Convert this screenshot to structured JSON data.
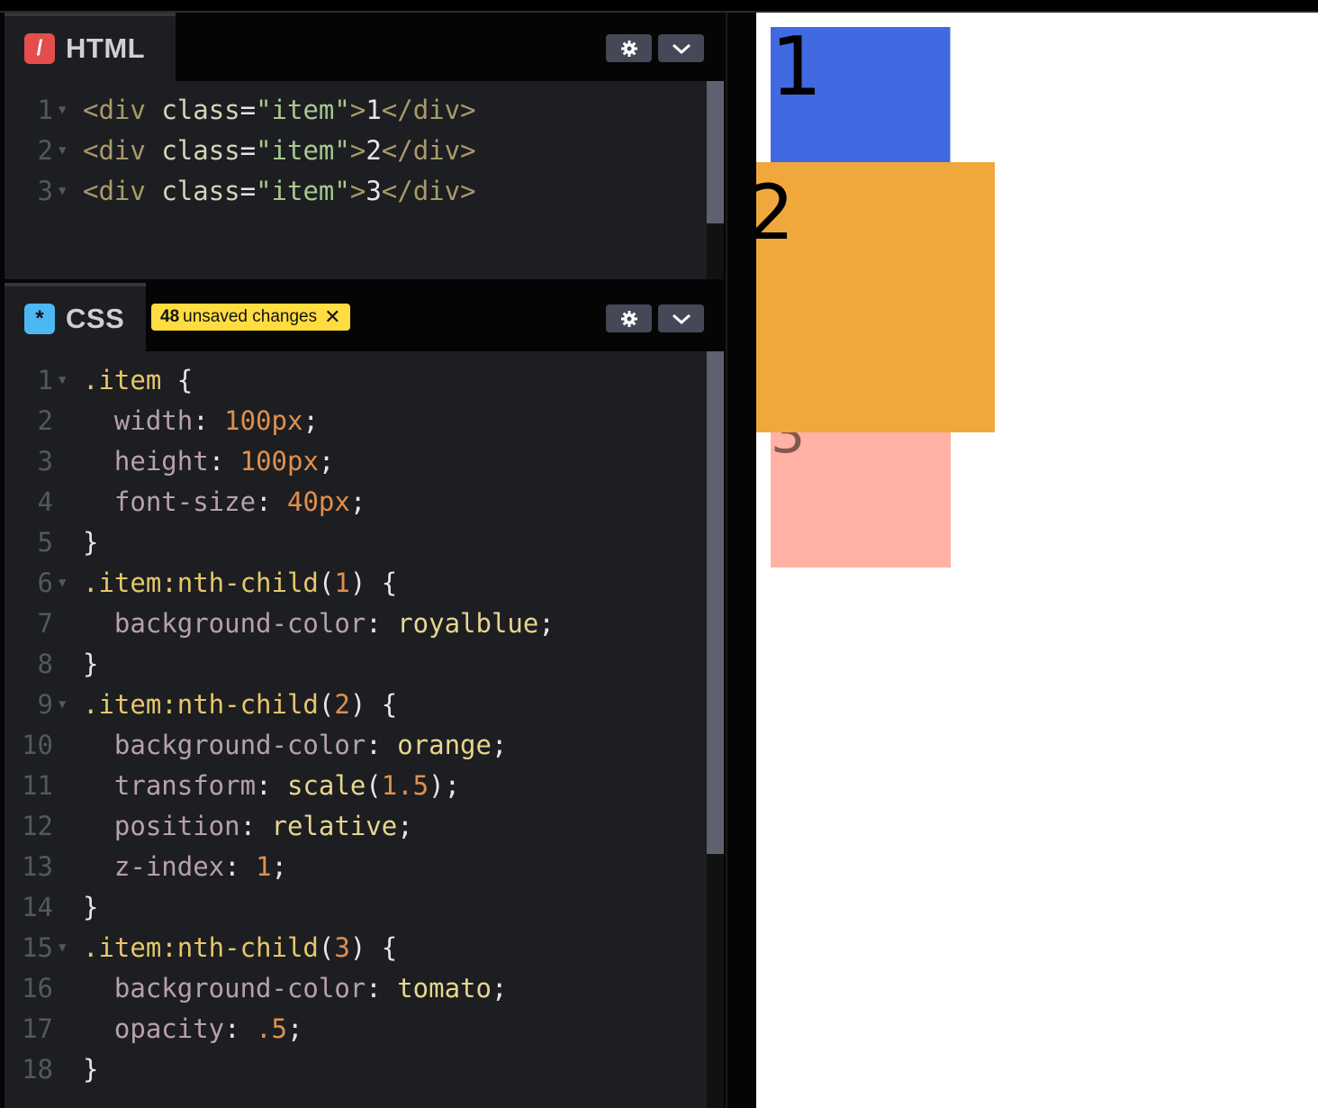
{
  "html_panel": {
    "language": "HTML",
    "icon": "slash-icon",
    "lines": [
      {
        "n": "1",
        "tokens": [
          [
            "t-tag",
            "<div "
          ],
          [
            "t-attr",
            "class"
          ],
          [
            "t-white",
            "="
          ],
          [
            "t-str",
            "\"item\""
          ],
          [
            "t-tag",
            ">"
          ],
          [
            "t-white",
            "1"
          ],
          [
            "t-tag",
            "</div>"
          ]
        ]
      },
      {
        "n": "2",
        "tokens": [
          [
            "t-tag",
            "<div "
          ],
          [
            "t-attr",
            "class"
          ],
          [
            "t-white",
            "="
          ],
          [
            "t-str",
            "\"item\""
          ],
          [
            "t-tag",
            ">"
          ],
          [
            "t-white",
            "2"
          ],
          [
            "t-tag",
            "</div>"
          ]
        ]
      },
      {
        "n": "3",
        "tokens": [
          [
            "t-tag",
            "<div "
          ],
          [
            "t-attr",
            "class"
          ],
          [
            "t-white",
            "="
          ],
          [
            "t-str",
            "\"item\""
          ],
          [
            "t-tag",
            ">"
          ],
          [
            "t-white",
            "3"
          ],
          [
            "t-tag",
            "</div>"
          ]
        ]
      }
    ],
    "fold_lines": [
      "1",
      "2",
      "3"
    ]
  },
  "css_panel": {
    "language": "CSS",
    "icon": "asterisk-icon",
    "unsaved_count": "48",
    "unsaved_text": "unsaved changes",
    "lines": [
      {
        "n": "1",
        "tokens": [
          [
            "t-sel",
            ".item "
          ],
          [
            "t-white",
            "{"
          ]
        ]
      },
      {
        "n": "2",
        "tokens": [
          [
            "t-prop",
            "  width"
          ],
          [
            "t-white",
            ": "
          ],
          [
            "t-num",
            "100px"
          ],
          [
            "t-white",
            ";"
          ]
        ]
      },
      {
        "n": "3",
        "tokens": [
          [
            "t-prop",
            "  height"
          ],
          [
            "t-white",
            ": "
          ],
          [
            "t-num",
            "100px"
          ],
          [
            "t-white",
            ";"
          ]
        ]
      },
      {
        "n": "4",
        "tokens": [
          [
            "t-prop",
            "  font-size"
          ],
          [
            "t-white",
            ": "
          ],
          [
            "t-num",
            "40px"
          ],
          [
            "t-white",
            ";"
          ]
        ]
      },
      {
        "n": "5",
        "tokens": [
          [
            "t-white",
            "}"
          ]
        ]
      },
      {
        "n": "6",
        "tokens": [
          [
            "t-sel",
            ".item:nth-child"
          ],
          [
            "t-white",
            "("
          ],
          [
            "t-num",
            "1"
          ],
          [
            "t-white",
            ") {"
          ]
        ]
      },
      {
        "n": "7",
        "tokens": [
          [
            "t-prop",
            "  background-color"
          ],
          [
            "t-white",
            ": "
          ],
          [
            "t-kw",
            "royalblue"
          ],
          [
            "t-white",
            ";"
          ]
        ]
      },
      {
        "n": "8",
        "tokens": [
          [
            "t-white",
            "}"
          ]
        ]
      },
      {
        "n": "9",
        "tokens": [
          [
            "t-sel",
            ".item:nth-child"
          ],
          [
            "t-white",
            "("
          ],
          [
            "t-num",
            "2"
          ],
          [
            "t-white",
            ") {"
          ]
        ]
      },
      {
        "n": "10",
        "tokens": [
          [
            "t-prop",
            "  background-color"
          ],
          [
            "t-white",
            ": "
          ],
          [
            "t-kw",
            "orange"
          ],
          [
            "t-white",
            ";"
          ]
        ]
      },
      {
        "n": "11",
        "tokens": [
          [
            "t-prop",
            "  transform"
          ],
          [
            "t-white",
            ": "
          ],
          [
            "t-kw",
            "scale"
          ],
          [
            "t-white",
            "("
          ],
          [
            "t-num",
            "1.5"
          ],
          [
            "t-white",
            ");"
          ]
        ]
      },
      {
        "n": "12",
        "tokens": [
          [
            "t-prop",
            "  position"
          ],
          [
            "t-white",
            ": "
          ],
          [
            "t-kw",
            "relative"
          ],
          [
            "t-white",
            ";"
          ]
        ]
      },
      {
        "n": "13",
        "tokens": [
          [
            "t-prop",
            "  z-index"
          ],
          [
            "t-white",
            ": "
          ],
          [
            "t-num",
            "1"
          ],
          [
            "t-white",
            ";"
          ]
        ]
      },
      {
        "n": "14",
        "tokens": [
          [
            "t-white",
            "}"
          ]
        ]
      },
      {
        "n": "15",
        "tokens": [
          [
            "t-sel",
            ".item:nth-child"
          ],
          [
            "t-white",
            "("
          ],
          [
            "t-num",
            "3"
          ],
          [
            "t-white",
            ") {"
          ]
        ]
      },
      {
        "n": "16",
        "tokens": [
          [
            "t-prop",
            "  background-color"
          ],
          [
            "t-white",
            ": "
          ],
          [
            "t-kw",
            "tomato"
          ],
          [
            "t-white",
            ";"
          ]
        ]
      },
      {
        "n": "17",
        "tokens": [
          [
            "t-prop",
            "  opacity"
          ],
          [
            "t-white",
            ": "
          ],
          [
            "t-num",
            ".5"
          ],
          [
            "t-white",
            ";"
          ]
        ]
      },
      {
        "n": "18",
        "tokens": [
          [
            "t-white",
            "}"
          ]
        ]
      }
    ],
    "fold_lines": [
      "1",
      "6",
      "9",
      "15"
    ]
  },
  "preview": {
    "items": [
      {
        "label": "1",
        "color": "#4169e1"
      },
      {
        "label": "2",
        "color": "#f0a83c"
      },
      {
        "label": "3",
        "color": "#ff6347"
      }
    ]
  },
  "colors": {
    "unsaved_badge": "#ffdd40",
    "html_icon": "#e54d4d",
    "css_icon": "#4bb7f3"
  }
}
